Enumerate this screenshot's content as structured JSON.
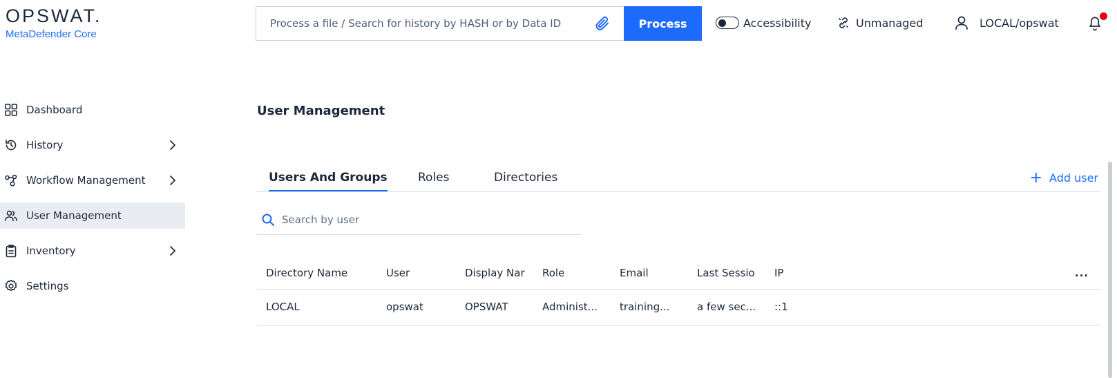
{
  "brand": {
    "logo_text": "OPSWAT.",
    "product": "MetaDefender Core",
    "brand_color": "#1d6bfc"
  },
  "header": {
    "search_placeholder": "Process a file / Search for history by HASH or by Data ID",
    "process_label": "Process",
    "accessibility_label": "Accessibility",
    "unmanaged_label": "Unmanaged",
    "user_label": "LOCAL/opswat",
    "notification_color": "#e0001b"
  },
  "sidebar": {
    "items": [
      {
        "label": "Dashboard",
        "icon": "dashboard-grid-icon",
        "has_chevron": false,
        "active": false
      },
      {
        "label": "History",
        "icon": "history-icon",
        "has_chevron": true,
        "active": false
      },
      {
        "label": "Workflow Management",
        "icon": "workflow-icon",
        "has_chevron": true,
        "active": false
      },
      {
        "label": "User Management",
        "icon": "users-icon",
        "has_chevron": false,
        "active": true
      },
      {
        "label": "Inventory",
        "icon": "clipboard-icon",
        "has_chevron": true,
        "active": false
      },
      {
        "label": "Settings",
        "icon": "gear-icon",
        "has_chevron": false,
        "active": false
      }
    ]
  },
  "main": {
    "title": "User Management",
    "tabs": [
      {
        "label": "Users And Groups",
        "active": true
      },
      {
        "label": "Roles",
        "active": false
      },
      {
        "label": "Directories",
        "active": false
      }
    ],
    "add_user_label": "Add user",
    "search_placeholder": "Search by user",
    "table": {
      "columns": [
        "Directory Name",
        "User",
        "Display Nar",
        "Role",
        "Email",
        "Last Sessio",
        "IP"
      ],
      "more_label": "...",
      "rows": [
        [
          "LOCAL",
          "opswat",
          "OPSWAT",
          "Administ...",
          "training...",
          "a few sec...",
          "::1"
        ]
      ]
    }
  }
}
